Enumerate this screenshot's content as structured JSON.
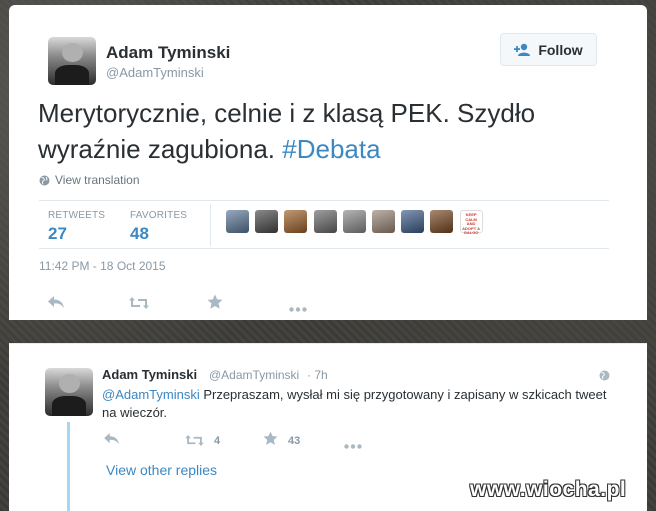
{
  "tweet": {
    "author_name": "Adam Tyminski",
    "author_handle": "@AdamTyminski",
    "follow_label": "Follow",
    "text_main": "Merytorycznie, celnie i z klasą PEK. Szydło wyraźnie zagubiona. ",
    "hashtag": "#Debata",
    "view_translation": "View translation",
    "retweets_label": "RETWEETS",
    "retweets_count": "27",
    "favorites_label": "FAVORITES",
    "favorites_count": "48",
    "timestamp": "11:42 PM - 18 Oct 2015",
    "favoriter_avatars": [
      {
        "name": "avatar-1",
        "color": "#5f7b9c"
      },
      {
        "name": "avatar-2",
        "color": "#4a4a4a"
      },
      {
        "name": "avatar-3",
        "color": "#a0642b"
      },
      {
        "name": "avatar-4",
        "color": "#6b6b6b"
      },
      {
        "name": "avatar-5",
        "color": "#8d8d8d"
      },
      {
        "name": "avatar-6",
        "color": "#9c8878"
      },
      {
        "name": "avatar-7",
        "color": "#3e5f8a"
      },
      {
        "name": "avatar-8",
        "color": "#7a4a22"
      },
      {
        "name": "avatar-9-keep-calm",
        "color": "#ffffff"
      }
    ],
    "keep_calm_text": "KEEP CALM AND ADOPT A GALGO"
  },
  "reply": {
    "author_name": "Adam Tyminski",
    "author_handle": "@AdamTyminski",
    "time": "· 7h",
    "mention": "@AdamTyminski",
    "text": " Przepraszam, wysłał mi się przygotowany i zapisany w szkicach tweet na wieczór.",
    "retweet_count": "4",
    "favorite_count": "43",
    "view_other_replies": "View other replies"
  },
  "watermark": "www.wiocha.pl",
  "colors": {
    "link": "#3b88c3",
    "text": "#292f33",
    "muted": "#8899a6"
  }
}
